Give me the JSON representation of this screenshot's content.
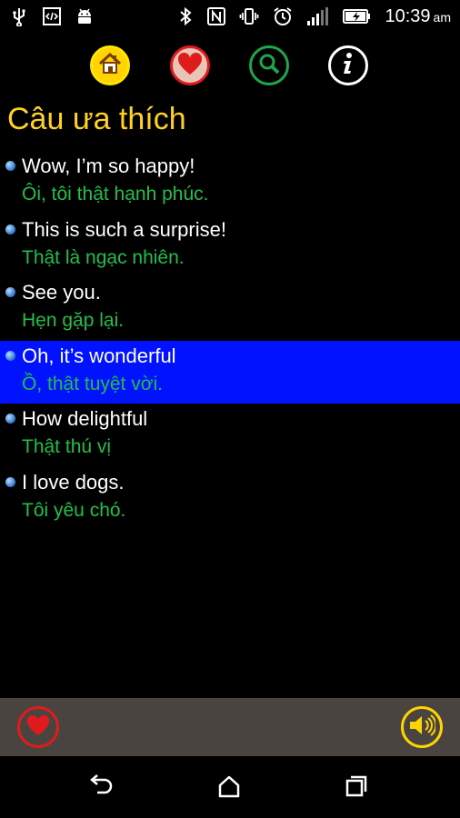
{
  "status": {
    "time": "10:39",
    "ampm": "am",
    "icons": [
      "usb-icon",
      "developer-icon",
      "android-icon",
      "bluetooth-icon",
      "nfc-icon",
      "vibrate-icon",
      "alarm-icon",
      "signal-icon",
      "battery-charging-icon"
    ]
  },
  "toolbar": {
    "buttons": [
      "home-icon",
      "heart-icon",
      "search-icon",
      "info-icon"
    ]
  },
  "page": {
    "title": "Câu ưa thích"
  },
  "phrases": [
    {
      "en": "Wow, I’m so happy!",
      "vi": "Ôi, tôi thật hạnh phúc."
    },
    {
      "en": "This is such a surprise!",
      "vi": "Thật là ngạc nhiên."
    },
    {
      "en": "See you.",
      "vi": "Hẹn gặp lại."
    },
    {
      "en": "Oh, it’s wonderful",
      "vi": "Ồ, thật tuyệt vời."
    },
    {
      "en": "How delightful",
      "vi": "Thật thú vị"
    },
    {
      "en": "I love dogs.",
      "vi": "Tôi yêu chó."
    }
  ],
  "selected_index": 3,
  "colors": {
    "title": "#ffd21e",
    "translation": "#1fbf4a",
    "selected_row": "#0012ff",
    "action_bar": "#4a4440",
    "favorite": "#e01b1b",
    "speaker": "#ffd400"
  }
}
